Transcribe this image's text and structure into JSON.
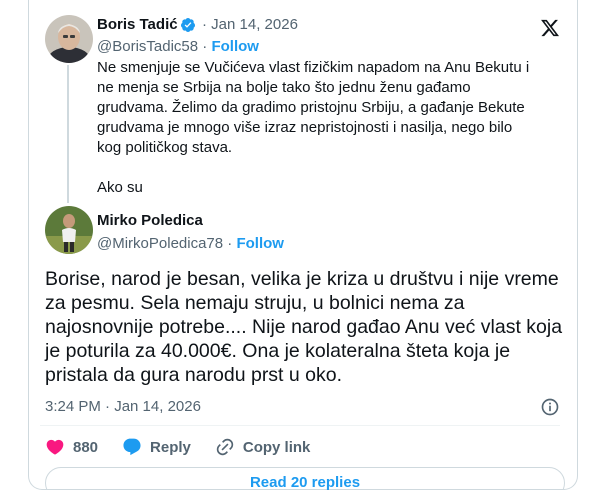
{
  "quoted_post": {
    "author_name": "Boris Tadić",
    "date": "Jan 14, 2026",
    "handle": "@BorisTadic58",
    "follow_label": "Follow",
    "paragraph_1": "Ne smenjuje se Vučićeva vlast fizičkim napadom na Anu Bekutu i ne menja se Srbija na bolje tako što jednu ženu gađamo grudvama. Želimo da gradimo pristojnu Srbiju, a gađanje Bekute grudvama je mnogo više izraz nepristojnosti i nasilja, nego bilo kog političkog stava.",
    "paragraph_2": "Ako su"
  },
  "reply_post": {
    "author_name": "Mirko Poledica",
    "handle": "@MirkoPoledica78",
    "follow_label": "Follow",
    "text": "Borise, narod je besan, velika je kriza u društvu i nije vreme za pesmu. Sela nemaju struju, u bolnici nema za najosnovnije potrebe.... Nije narod gađao Anu već vlast koja je poturila za 40.000€. Ona je kolateralna šteta koja je pristala da gura narodu prst u oko.",
    "timestamp": "3:24 PM · Jan 14, 2026"
  },
  "actions": {
    "like_count": "880",
    "reply_label": "Reply",
    "copy_link_label": "Copy link"
  },
  "read_replies_label": "Read 20 replies",
  "separator": "·",
  "icons": {
    "logo": "x-logo-icon",
    "verified": "verified-badge-icon",
    "like": "heart-icon",
    "reply": "speech-bubble-icon",
    "copy": "link-icon",
    "info": "info-icon"
  },
  "colors": {
    "accent": "#1d9bf0",
    "like": "#f91880",
    "muted": "#536471",
    "text": "#0f1419",
    "border": "#cfd9de"
  }
}
